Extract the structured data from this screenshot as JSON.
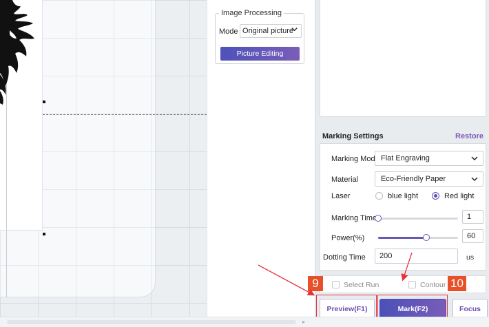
{
  "image_processing": {
    "title": "Image Processing",
    "mode_label": "Mode",
    "mode_value": "Original picture",
    "picture_editing_label": "Picture Editing"
  },
  "marking_settings": {
    "header": "Marking Settings",
    "restore_label": "Restore",
    "marking_mode_label": "Marking Mode",
    "marking_mode_value": "Flat Engraving",
    "material_label": "Material",
    "material_value": "Eco-Friendly Paper",
    "laser_label": "Laser",
    "laser_options": [
      {
        "label": "blue light",
        "checked": false
      },
      {
        "label": "Red light",
        "checked": true
      }
    ],
    "marking_times_label": "Marking Times",
    "marking_times_value": "1",
    "power_label": "Power(%)",
    "power_value": "60",
    "dotting_time_label": "Dotting Time",
    "dotting_time_value": "200",
    "dotting_time_unit": "us"
  },
  "options": {
    "select_run_label": "Select Run",
    "contour_label": "Contour"
  },
  "actions": {
    "preview_label": "Preview(F1)",
    "mark_label": "Mark(F2)",
    "focus_label": "Focus"
  },
  "annotations": {
    "step_9": "9",
    "step_10": "10",
    "color": "#e4343a"
  },
  "colors": {
    "accent": "#6a57b8",
    "button_gradient_start": "#4b50b8",
    "button_gradient_end": "#7a5cb8"
  }
}
